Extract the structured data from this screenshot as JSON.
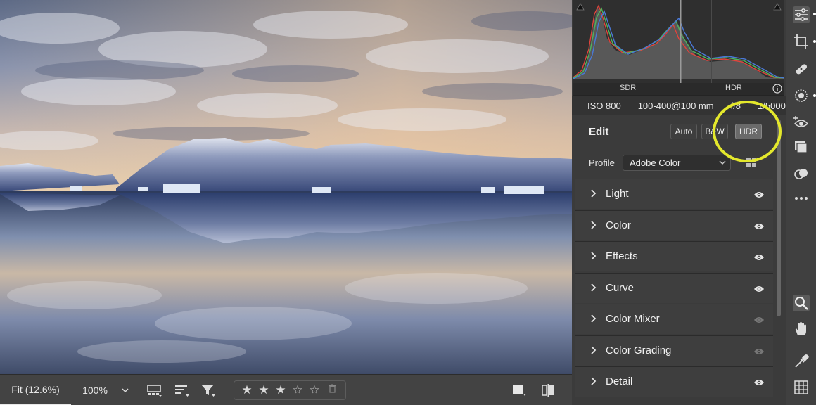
{
  "bottom_bar": {
    "fit_label": "Fit (12.6%)",
    "zoom_label": "100%",
    "rating": {
      "value": 3,
      "max": 5,
      "filled_star": "★",
      "empty_star": "☆"
    },
    "icons": [
      "filmstrip-view-icon",
      "sort-icon",
      "filter-icon",
      "trash-icon",
      "preview-toggle-icon",
      "before-after-icon"
    ]
  },
  "histogram": {
    "sdr_label": "SDR",
    "hdr_label": "HDR",
    "info_icon": "info-icon",
    "channel_colors": {
      "red": "#e0443c",
      "green": "#4fb35c",
      "blue": "#4a79d6"
    }
  },
  "exif": {
    "iso": "ISO 800",
    "lens": "100-400@100 mm",
    "aperture": "f/8",
    "shutter": "1/5000s"
  },
  "edit": {
    "title": "Edit",
    "auto_label": "Auto",
    "bw_label": "B&W",
    "hdr_label": "HDR",
    "highlight_color": "#e4e82c"
  },
  "profile": {
    "label": "Profile",
    "value": "Adobe Color"
  },
  "sections": [
    {
      "label": "Light",
      "visible_icon": "eye-icon",
      "eye_active": true
    },
    {
      "label": "Color",
      "visible_icon": "eye-icon",
      "eye_active": true
    },
    {
      "label": "Effects",
      "visible_icon": "eye-icon",
      "eye_active": true
    },
    {
      "label": "Curve",
      "visible_icon": "eye-icon",
      "eye_active": true
    },
    {
      "label": "Color Mixer",
      "visible_icon": "eye-icon",
      "eye_active": false
    },
    {
      "label": "Color Grading",
      "visible_icon": "eye-icon",
      "eye_active": false
    },
    {
      "label": "Detail",
      "visible_icon": "eye-icon",
      "eye_active": true
    }
  ],
  "toolstrip": [
    "edit-sliders-icon",
    "crop-icon",
    "healing-icon",
    "masking-icon",
    "red-eye-icon",
    "presets-icon",
    "snapshots-icon",
    "more-icon",
    "zoom-icon",
    "hand-icon",
    "color-sampler-icon",
    "grid-icon"
  ]
}
